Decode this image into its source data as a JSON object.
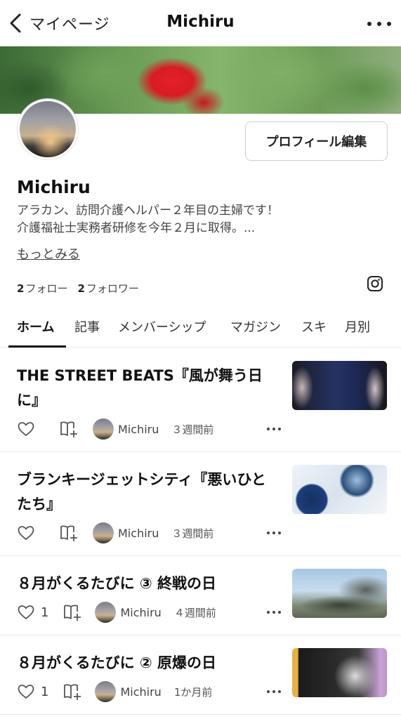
{
  "nav": {
    "back_label": "マイページ",
    "title": "Michiru"
  },
  "profile": {
    "name": "Michiru",
    "bio_line1": "アラカン、訪問介護ヘルパー２年目の主婦です！",
    "bio_line2": "介護福祉士実務者研修を今年２月に取得。...",
    "more_link": "もっとみる",
    "edit_button": "プロフィール編集",
    "following_count": "2",
    "following_label": "フォロー",
    "followers_count": "2",
    "followers_label": "フォロワー"
  },
  "tabs": [
    {
      "label": "ホーム",
      "active": true
    },
    {
      "label": "記事"
    },
    {
      "label": "メンバーシップ"
    },
    {
      "label": "マガジン"
    },
    {
      "label": "スキ"
    },
    {
      "label": "月別"
    }
  ],
  "articles": [
    {
      "title_line1": "THE STREET BEATS『風が舞う日",
      "title_line2": "に』",
      "likes": "",
      "author": "Michiru",
      "time": "３週間前"
    },
    {
      "title_line1": "ブランキージェットシティ『悪いひと",
      "title_line2": "たち』",
      "likes": "",
      "author": "Michiru",
      "time": "３週間前"
    },
    {
      "title_line1": "８月がくるたびに ③ 終戦の日",
      "likes": "1",
      "author": "Michiru",
      "time": "４週間前"
    },
    {
      "title_line1": "８月がくるたびに ② 原爆の日",
      "likes": "1",
      "author": "Michiru",
      "time": "1か月前"
    }
  ],
  "icons": {
    "back": "chevron-left-icon",
    "more": "ellipsis-icon",
    "instagram": "instagram-icon",
    "like": "heart-icon",
    "magazine": "add-to-magazine-icon"
  }
}
